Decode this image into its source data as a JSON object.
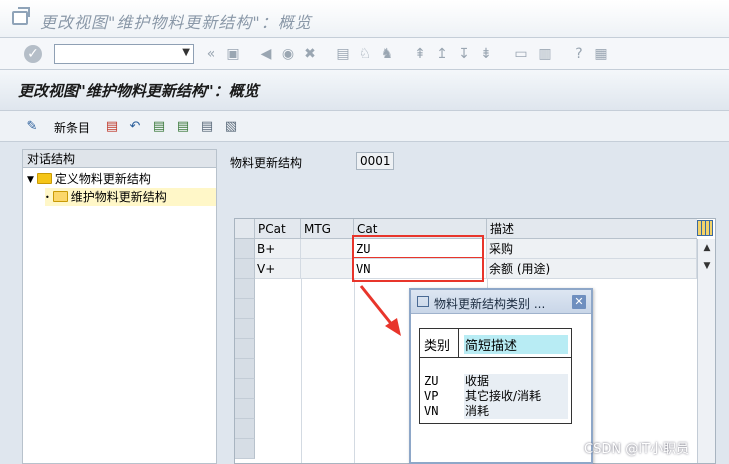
{
  "window": {
    "title": "更改视图\"维护物料更新结构\"：概览"
  },
  "page": {
    "title": "更改视图\"维护物料更新结构\"：概览"
  },
  "app_toolbar": {
    "new_entries_label": "新条目"
  },
  "tree": {
    "header": "对话结构",
    "items": [
      {
        "label": "定义物料更新结构",
        "level": 0,
        "expanded": true
      },
      {
        "label": "维护物料更新结构",
        "level": 1,
        "selected": true
      }
    ]
  },
  "structure_field": {
    "label": "物料更新结构",
    "value": "0001"
  },
  "table": {
    "columns": [
      "PCat",
      "MTG",
      "Cat",
      "描述"
    ],
    "rows": [
      {
        "pcat": "B+",
        "mtg": "",
        "cat": "ZU",
        "desc": "采购"
      },
      {
        "pcat": "V+",
        "mtg": "",
        "cat": "VN",
        "desc": "余额 (用途)"
      }
    ]
  },
  "popup": {
    "title": "物料更新结构类别 ...",
    "header_cat": "类别",
    "header_desc": "简短描述",
    "rows": [
      {
        "code": "ZU",
        "desc": "收据"
      },
      {
        "code": "VP",
        "desc": "其它接收/消耗"
      },
      {
        "code": "VN",
        "desc": "消耗"
      }
    ]
  },
  "watermark": "CSDN @IT小职员",
  "colors": {
    "highlight": "#e8352b",
    "popup_header_highlight": "#b8ecf4",
    "tree_selection": "#fff7c8"
  }
}
